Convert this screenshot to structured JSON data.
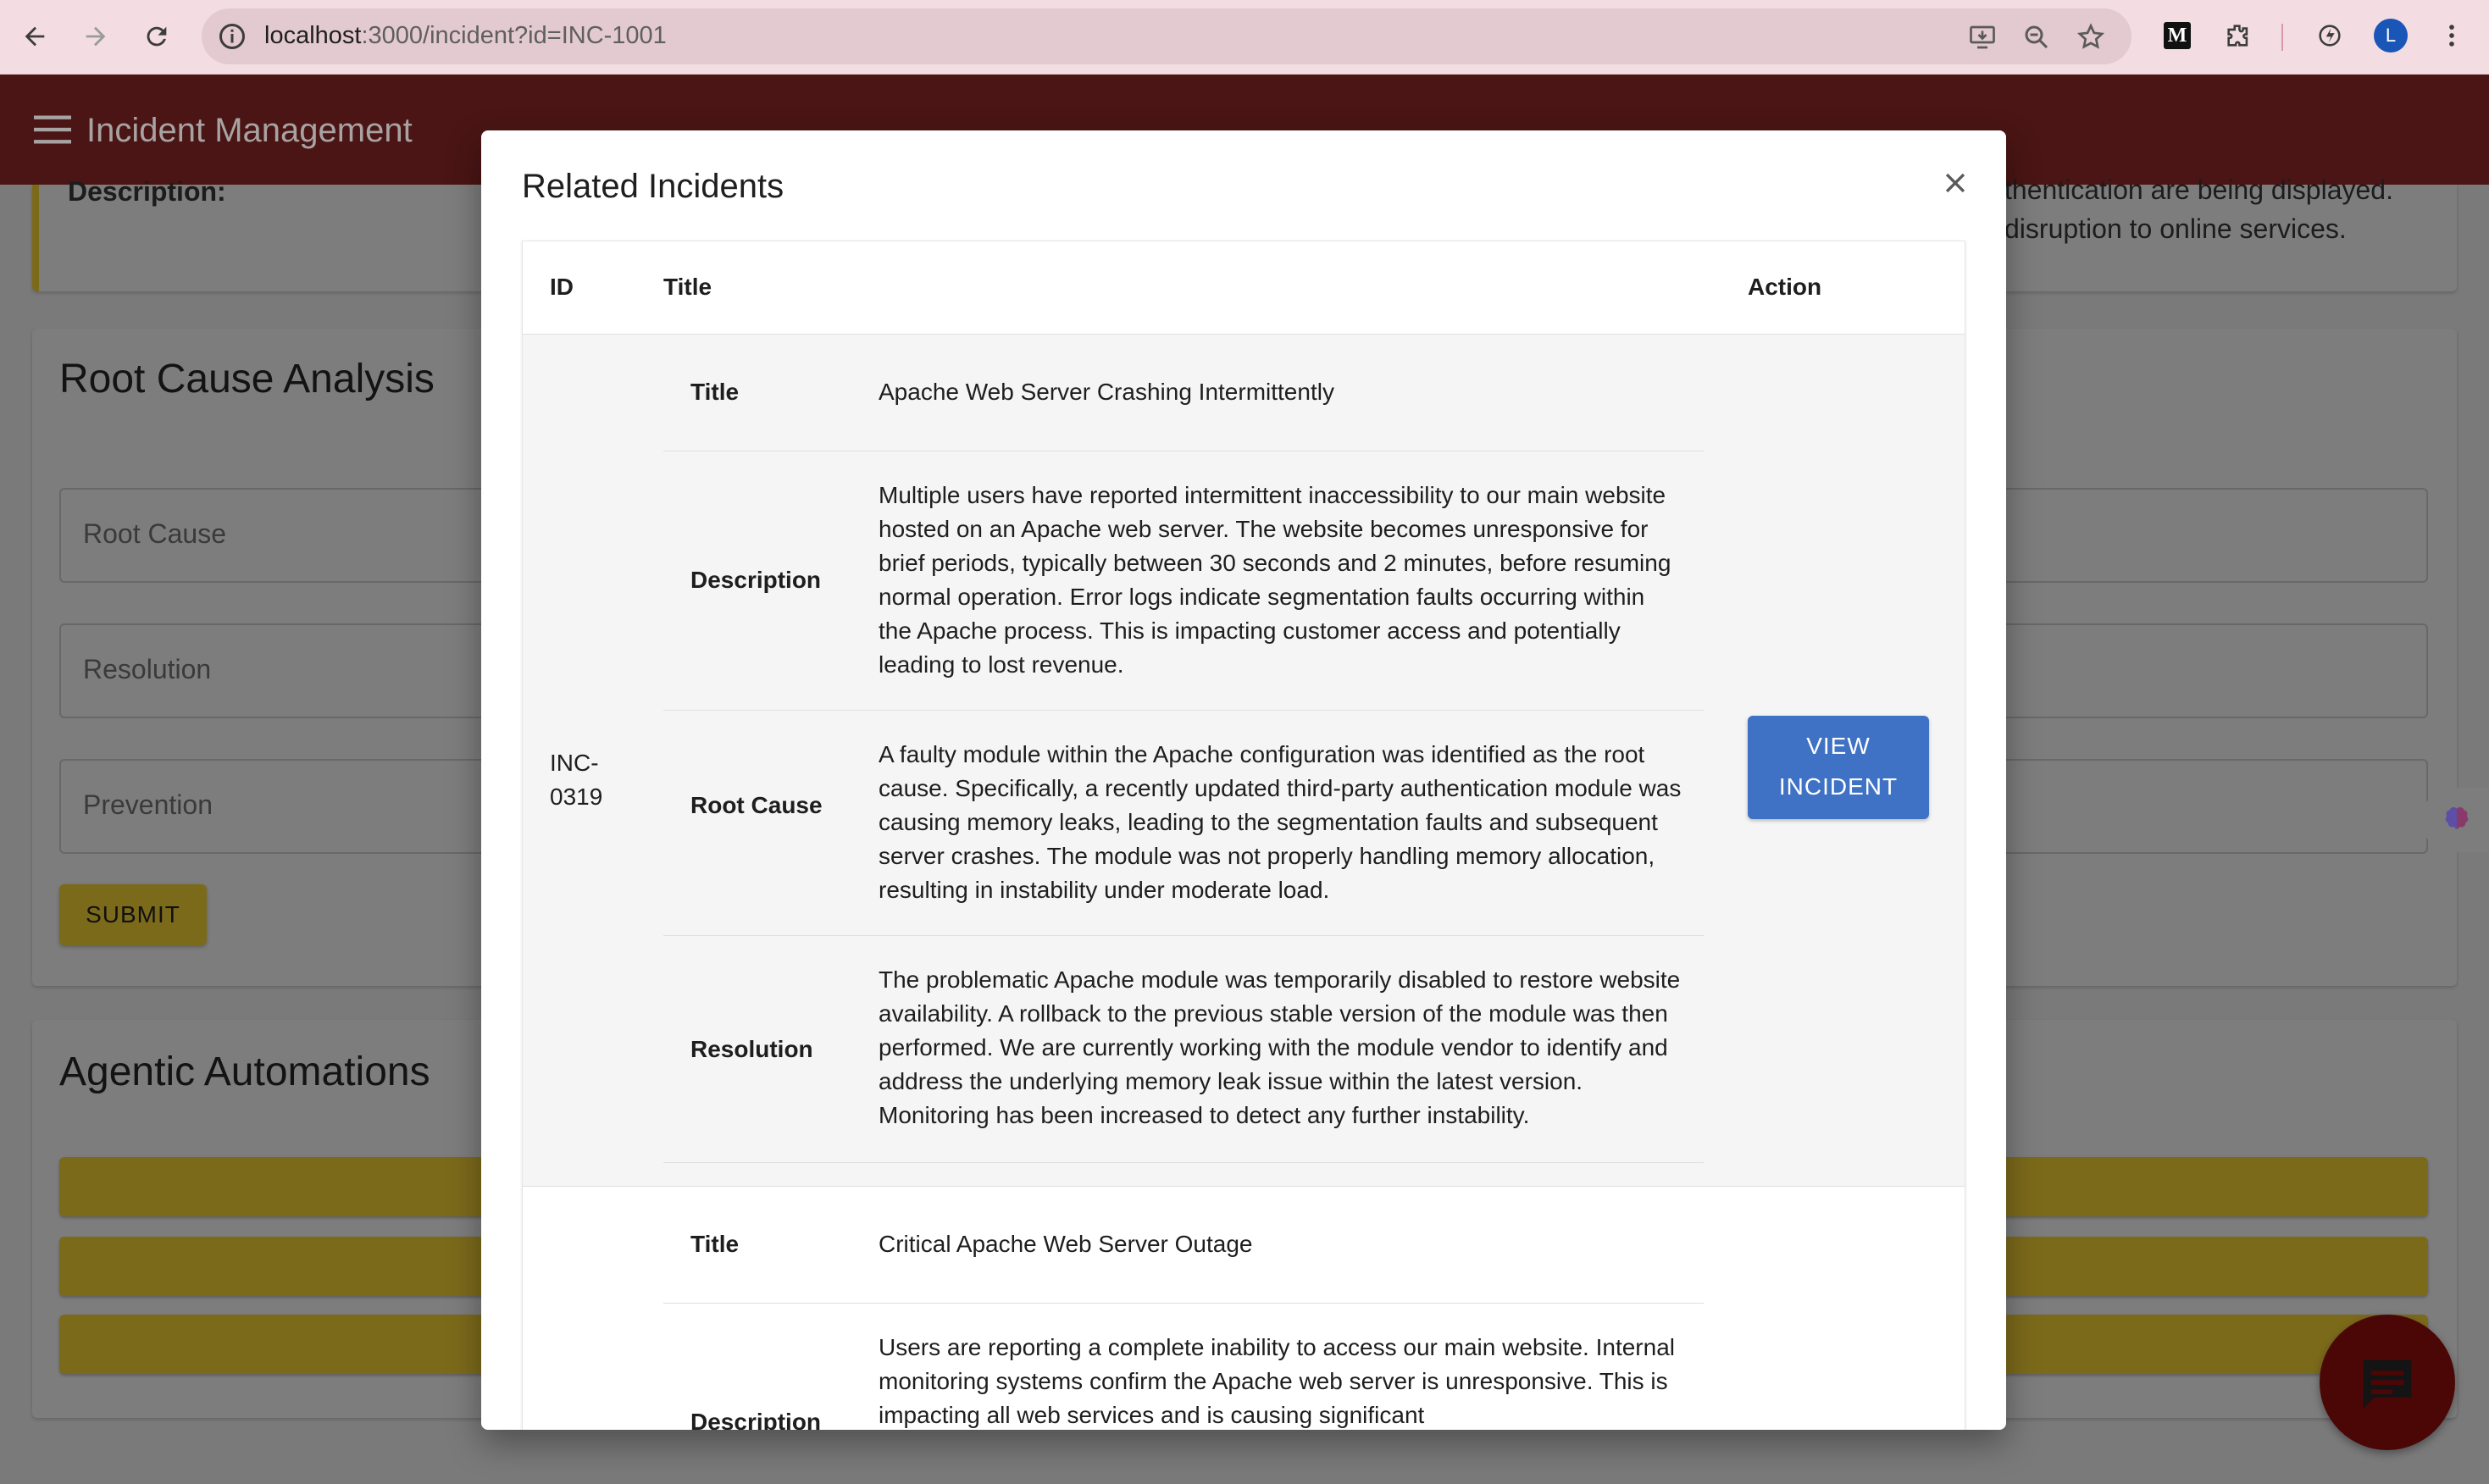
{
  "browser": {
    "url_host": "localhost",
    "url_rest": ":3000/incident?id=INC-1001",
    "extension_m_label": "M",
    "avatar_initial": "L"
  },
  "app": {
    "title": "Incident Management"
  },
  "background": {
    "description_label": "Description:",
    "description_fragment_1": "thentication are being displayed.",
    "description_fragment_2": "disruption to online services.",
    "rca_title": "Root Cause Analysis",
    "rca_fields": [
      "Root Cause",
      "Resolution",
      "Prevention"
    ],
    "submit_label": "SUBMIT",
    "automations_title": "Agentic Automations"
  },
  "modal": {
    "title": "Related Incidents",
    "columns": {
      "id": "ID",
      "title": "Title",
      "action": "Action"
    },
    "incidents": [
      {
        "id": "INC-0319",
        "fields": [
          {
            "key": "Title",
            "value": "Apache Web Server Crashing Intermittently"
          },
          {
            "key": "Description",
            "value": "Multiple users have reported intermittent inaccessibility to our main website hosted on an Apache web server. The website becomes unresponsive for brief periods, typically between 30 seconds and 2 minutes, before resuming normal operation. Error logs indicate segmentation faults occurring within the Apache process. This is impacting customer access and potentially leading to lost revenue."
          },
          {
            "key": "Root Cause",
            "value": "A faulty module within the Apache configuration was identified as the root cause. Specifically, a recently updated third-party authentication module was causing memory leaks, leading to the segmentation faults and subsequent server crashes. The module was not properly handling memory allocation, resulting in instability under moderate load."
          },
          {
            "key": "Resolution",
            "value": "The problematic Apache module was temporarily disabled to restore website availability. A rollback to the previous stable version of the module was then performed. We are currently working with the module vendor to identify and address the underlying memory leak issue within the latest version. Monitoring has been increased to detect any further instability."
          }
        ],
        "action_label": "VIEW INCIDENT"
      },
      {
        "fields": [
          {
            "key": "Title",
            "value": "Critical Apache Web Server Outage"
          },
          {
            "key": "Description",
            "value": "Users are reporting a complete inability to access our main website. Internal monitoring systems confirm the Apache web server is unresponsive. This is impacting all web services and is causing significant"
          }
        ]
      }
    ]
  }
}
